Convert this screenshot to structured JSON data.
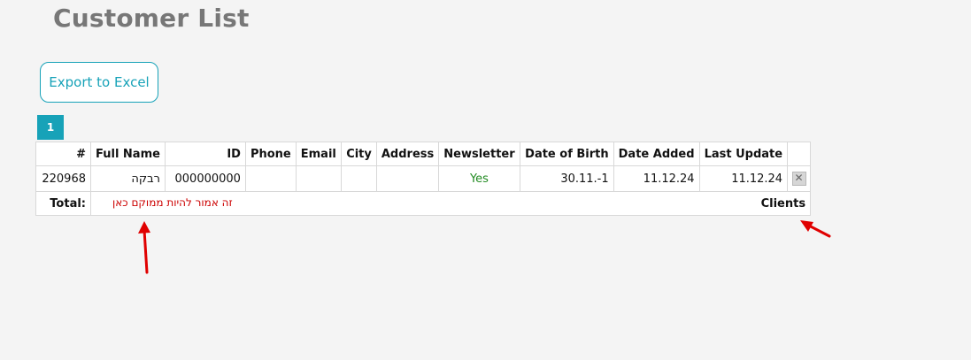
{
  "page": {
    "title": "Customer List"
  },
  "toolbar": {
    "export_label": "Export to Excel"
  },
  "pagination": {
    "pages": [
      "1"
    ],
    "current": "1"
  },
  "table": {
    "headers": {
      "num": "#",
      "full_name": "Full Name",
      "id": "ID",
      "phone": "Phone",
      "email": "Email",
      "city": "City",
      "address": "Address",
      "newsletter": "Newsletter",
      "dob": "Date of Birth",
      "date_added": "Date Added",
      "last_update": "Last Update"
    },
    "rows": [
      {
        "num": "220968",
        "full_name": "רבקה",
        "id": "000000000",
        "phone": "",
        "email": "",
        "city": "",
        "address": "",
        "newsletter": "Yes",
        "dob": "30.11.-1",
        "date_added": "11.12.24",
        "last_update": "11.12.24",
        "delete_glyph": "✕"
      }
    ],
    "footer": {
      "total_label": "Total:",
      "clients_label": "Clients"
    }
  },
  "annotations": {
    "note": "זה אמור להיות ממוקם כאן",
    "color": "#e00000"
  },
  "colors": {
    "accent": "#17a2b8",
    "yes": "#228b22",
    "background": "#f4f4f4"
  }
}
